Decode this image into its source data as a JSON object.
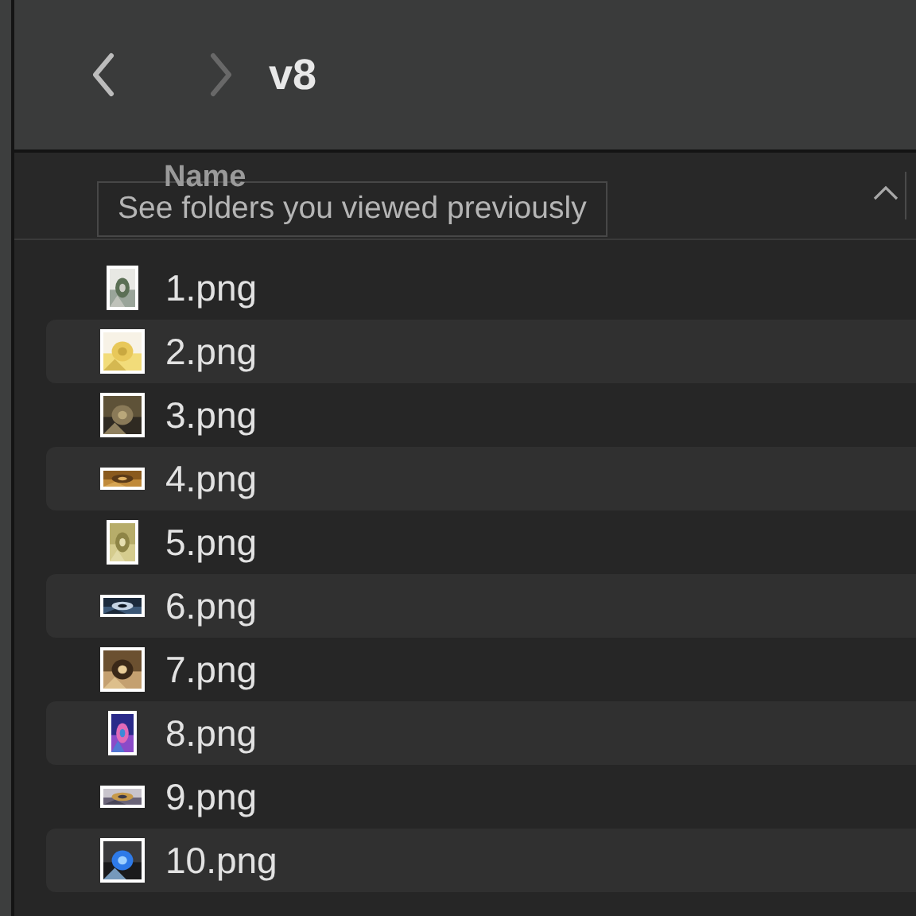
{
  "toolbar": {
    "back_button": {
      "disabled": false
    },
    "forward_button": {
      "disabled": true
    },
    "title": "v8"
  },
  "column_header": {
    "label": "Name",
    "sort_ascending": true
  },
  "tooltip": "See folders you viewed previously",
  "files": [
    {
      "name": "1.png",
      "kind": "picture"
    },
    {
      "name": "2.png",
      "kind": "picture"
    },
    {
      "name": "3.png",
      "kind": "picture"
    },
    {
      "name": "4.png",
      "kind": "picture"
    },
    {
      "name": "5.png",
      "kind": "picture"
    },
    {
      "name": "6.png",
      "kind": "picture"
    },
    {
      "name": "7.png",
      "kind": "picture"
    },
    {
      "name": "8.png",
      "kind": "picture"
    },
    {
      "name": "9.png",
      "kind": "picture"
    },
    {
      "name": "10.png",
      "kind": "picture"
    }
  ]
}
